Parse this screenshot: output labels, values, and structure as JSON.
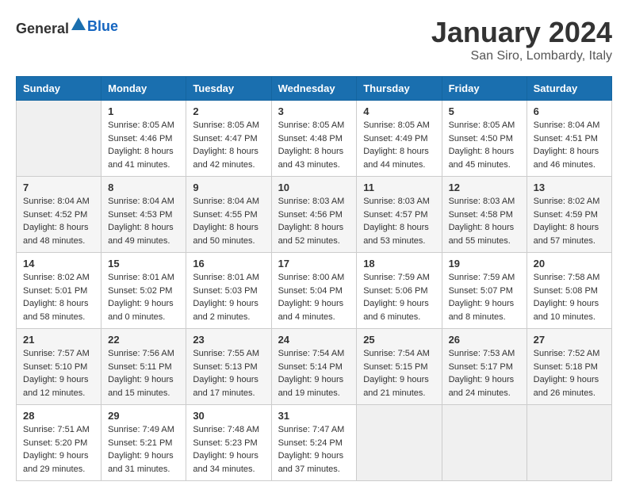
{
  "header": {
    "logo_general": "General",
    "logo_blue": "Blue",
    "month": "January 2024",
    "location": "San Siro, Lombardy, Italy"
  },
  "days_of_week": [
    "Sunday",
    "Monday",
    "Tuesday",
    "Wednesday",
    "Thursday",
    "Friday",
    "Saturday"
  ],
  "weeks": [
    [
      {
        "day": "",
        "sunrise": "",
        "sunset": "",
        "daylight": ""
      },
      {
        "day": "1",
        "sunrise": "Sunrise: 8:05 AM",
        "sunset": "Sunset: 4:46 PM",
        "daylight": "Daylight: 8 hours and 41 minutes."
      },
      {
        "day": "2",
        "sunrise": "Sunrise: 8:05 AM",
        "sunset": "Sunset: 4:47 PM",
        "daylight": "Daylight: 8 hours and 42 minutes."
      },
      {
        "day": "3",
        "sunrise": "Sunrise: 8:05 AM",
        "sunset": "Sunset: 4:48 PM",
        "daylight": "Daylight: 8 hours and 43 minutes."
      },
      {
        "day": "4",
        "sunrise": "Sunrise: 8:05 AM",
        "sunset": "Sunset: 4:49 PM",
        "daylight": "Daylight: 8 hours and 44 minutes."
      },
      {
        "day": "5",
        "sunrise": "Sunrise: 8:05 AM",
        "sunset": "Sunset: 4:50 PM",
        "daylight": "Daylight: 8 hours and 45 minutes."
      },
      {
        "day": "6",
        "sunrise": "Sunrise: 8:04 AM",
        "sunset": "Sunset: 4:51 PM",
        "daylight": "Daylight: 8 hours and 46 minutes."
      }
    ],
    [
      {
        "day": "7",
        "sunrise": "Sunrise: 8:04 AM",
        "sunset": "Sunset: 4:52 PM",
        "daylight": "Daylight: 8 hours and 48 minutes."
      },
      {
        "day": "8",
        "sunrise": "Sunrise: 8:04 AM",
        "sunset": "Sunset: 4:53 PM",
        "daylight": "Daylight: 8 hours and 49 minutes."
      },
      {
        "day": "9",
        "sunrise": "Sunrise: 8:04 AM",
        "sunset": "Sunset: 4:55 PM",
        "daylight": "Daylight: 8 hours and 50 minutes."
      },
      {
        "day": "10",
        "sunrise": "Sunrise: 8:03 AM",
        "sunset": "Sunset: 4:56 PM",
        "daylight": "Daylight: 8 hours and 52 minutes."
      },
      {
        "day": "11",
        "sunrise": "Sunrise: 8:03 AM",
        "sunset": "Sunset: 4:57 PM",
        "daylight": "Daylight: 8 hours and 53 minutes."
      },
      {
        "day": "12",
        "sunrise": "Sunrise: 8:03 AM",
        "sunset": "Sunset: 4:58 PM",
        "daylight": "Daylight: 8 hours and 55 minutes."
      },
      {
        "day": "13",
        "sunrise": "Sunrise: 8:02 AM",
        "sunset": "Sunset: 4:59 PM",
        "daylight": "Daylight: 8 hours and 57 minutes."
      }
    ],
    [
      {
        "day": "14",
        "sunrise": "Sunrise: 8:02 AM",
        "sunset": "Sunset: 5:01 PM",
        "daylight": "Daylight: 8 hours and 58 minutes."
      },
      {
        "day": "15",
        "sunrise": "Sunrise: 8:01 AM",
        "sunset": "Sunset: 5:02 PM",
        "daylight": "Daylight: 9 hours and 0 minutes."
      },
      {
        "day": "16",
        "sunrise": "Sunrise: 8:01 AM",
        "sunset": "Sunset: 5:03 PM",
        "daylight": "Daylight: 9 hours and 2 minutes."
      },
      {
        "day": "17",
        "sunrise": "Sunrise: 8:00 AM",
        "sunset": "Sunset: 5:04 PM",
        "daylight": "Daylight: 9 hours and 4 minutes."
      },
      {
        "day": "18",
        "sunrise": "Sunrise: 7:59 AM",
        "sunset": "Sunset: 5:06 PM",
        "daylight": "Daylight: 9 hours and 6 minutes."
      },
      {
        "day": "19",
        "sunrise": "Sunrise: 7:59 AM",
        "sunset": "Sunset: 5:07 PM",
        "daylight": "Daylight: 9 hours and 8 minutes."
      },
      {
        "day": "20",
        "sunrise": "Sunrise: 7:58 AM",
        "sunset": "Sunset: 5:08 PM",
        "daylight": "Daylight: 9 hours and 10 minutes."
      }
    ],
    [
      {
        "day": "21",
        "sunrise": "Sunrise: 7:57 AM",
        "sunset": "Sunset: 5:10 PM",
        "daylight": "Daylight: 9 hours and 12 minutes."
      },
      {
        "day": "22",
        "sunrise": "Sunrise: 7:56 AM",
        "sunset": "Sunset: 5:11 PM",
        "daylight": "Daylight: 9 hours and 15 minutes."
      },
      {
        "day": "23",
        "sunrise": "Sunrise: 7:55 AM",
        "sunset": "Sunset: 5:13 PM",
        "daylight": "Daylight: 9 hours and 17 minutes."
      },
      {
        "day": "24",
        "sunrise": "Sunrise: 7:54 AM",
        "sunset": "Sunset: 5:14 PM",
        "daylight": "Daylight: 9 hours and 19 minutes."
      },
      {
        "day": "25",
        "sunrise": "Sunrise: 7:54 AM",
        "sunset": "Sunset: 5:15 PM",
        "daylight": "Daylight: 9 hours and 21 minutes."
      },
      {
        "day": "26",
        "sunrise": "Sunrise: 7:53 AM",
        "sunset": "Sunset: 5:17 PM",
        "daylight": "Daylight: 9 hours and 24 minutes."
      },
      {
        "day": "27",
        "sunrise": "Sunrise: 7:52 AM",
        "sunset": "Sunset: 5:18 PM",
        "daylight": "Daylight: 9 hours and 26 minutes."
      }
    ],
    [
      {
        "day": "28",
        "sunrise": "Sunrise: 7:51 AM",
        "sunset": "Sunset: 5:20 PM",
        "daylight": "Daylight: 9 hours and 29 minutes."
      },
      {
        "day": "29",
        "sunrise": "Sunrise: 7:49 AM",
        "sunset": "Sunset: 5:21 PM",
        "daylight": "Daylight: 9 hours and 31 minutes."
      },
      {
        "day": "30",
        "sunrise": "Sunrise: 7:48 AM",
        "sunset": "Sunset: 5:23 PM",
        "daylight": "Daylight: 9 hours and 34 minutes."
      },
      {
        "day": "31",
        "sunrise": "Sunrise: 7:47 AM",
        "sunset": "Sunset: 5:24 PM",
        "daylight": "Daylight: 9 hours and 37 minutes."
      },
      {
        "day": "",
        "sunrise": "",
        "sunset": "",
        "daylight": ""
      },
      {
        "day": "",
        "sunrise": "",
        "sunset": "",
        "daylight": ""
      },
      {
        "day": "",
        "sunrise": "",
        "sunset": "",
        "daylight": ""
      }
    ]
  ]
}
